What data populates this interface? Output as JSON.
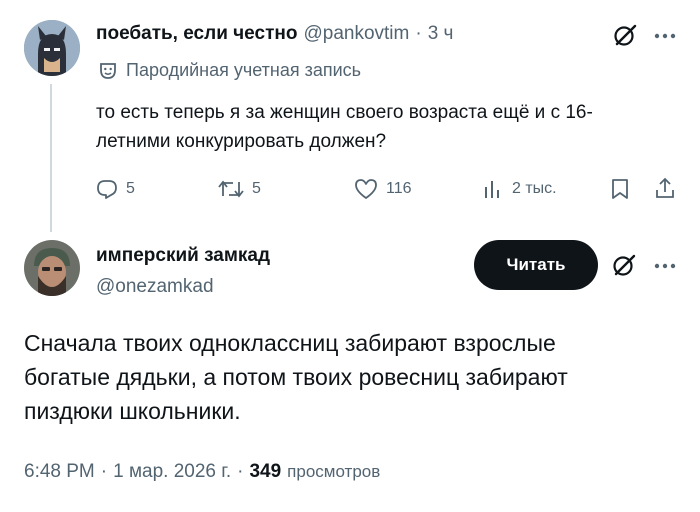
{
  "tweet1": {
    "name": "поебать, если честно",
    "handle": "@pankovtim",
    "sep": "·",
    "time": "3 ч",
    "label": "Пародийная учетная запись",
    "text": "то есть теперь я за женщин своего возраста ещё и с 16-летними конкурировать должен?",
    "actions": {
      "replies": "5",
      "reposts": "5",
      "likes": "116",
      "views": "2 тыс."
    },
    "icons": [
      "grok-icon",
      "more-icon",
      "reply-icon",
      "repost-icon",
      "like-icon",
      "views-icon",
      "bookmark-icon",
      "share-icon",
      "parody-mask-icon"
    ]
  },
  "tweet2": {
    "name": "имперский замкад",
    "handle": "@onezamkad",
    "follow_label": "Читать",
    "text": "Сначала твоих одноклассниц забирают взрослые богатые дядьки, а потом твоих ровесниц забирают пиздюки школьники.",
    "time": "6:48 PM",
    "sep1": "·",
    "date": "1 мар. 2026 г.",
    "sep2": "·",
    "views_count": "349",
    "views_label": "просмотров"
  },
  "colors": {
    "text": "#0f1419",
    "secondary": "#536471",
    "line": "#cfd9de",
    "button": "#0f1419"
  }
}
